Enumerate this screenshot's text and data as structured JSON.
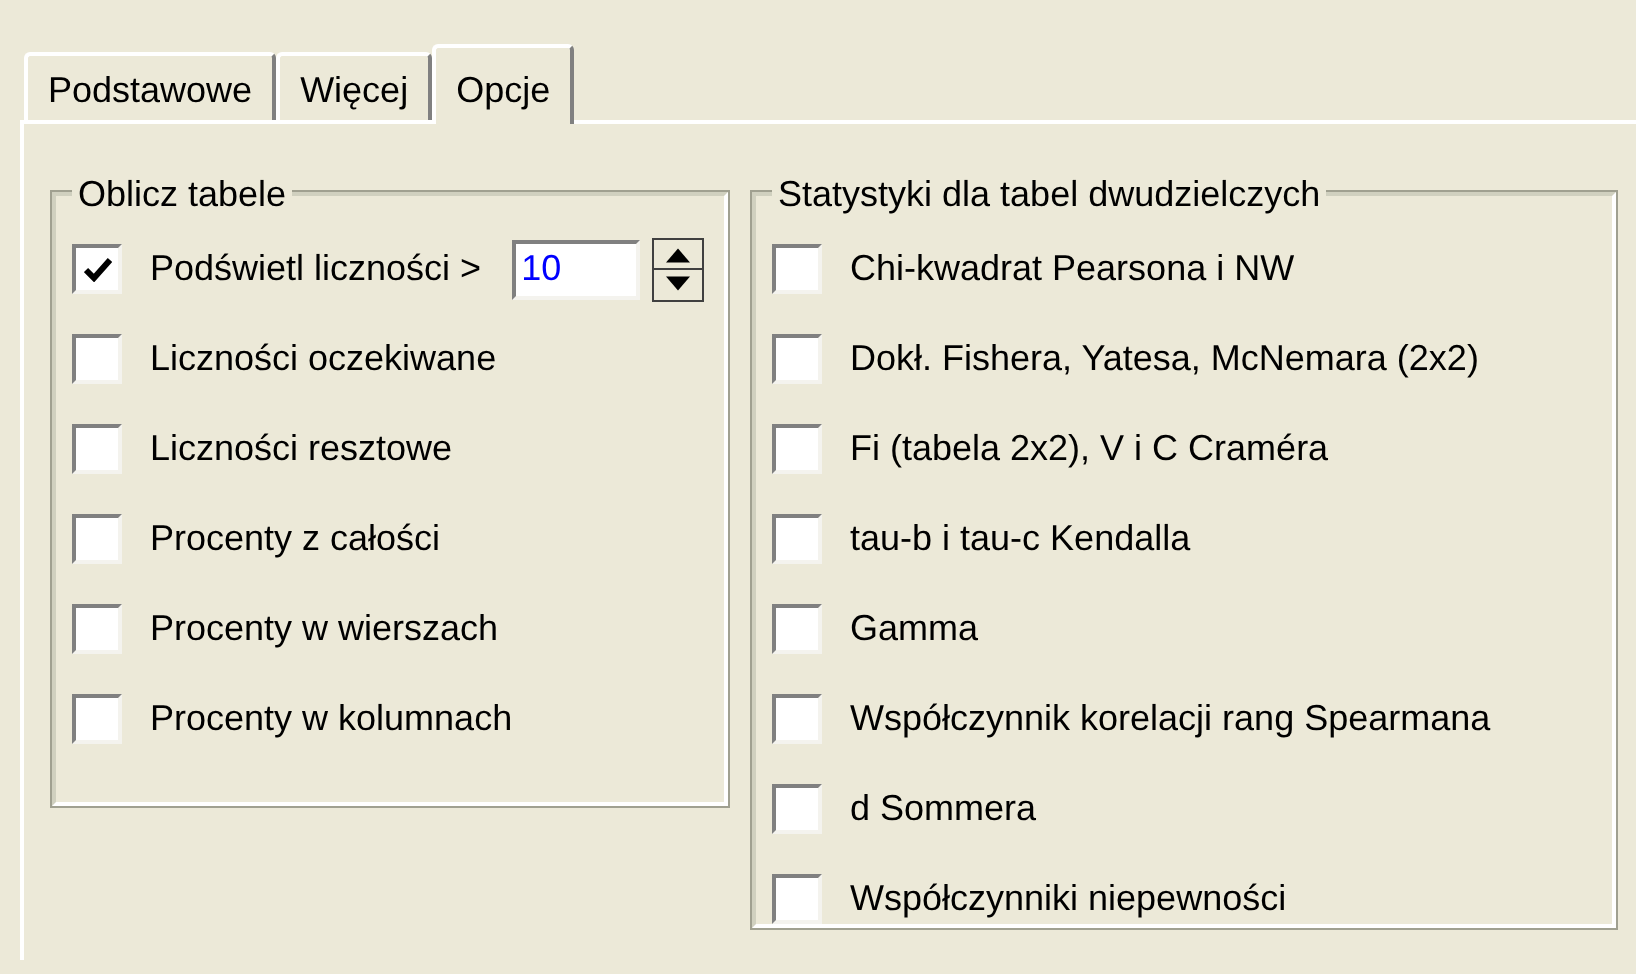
{
  "tabs": [
    {
      "label": "Podstawowe",
      "selected": false
    },
    {
      "label": "Więcej",
      "selected": false
    },
    {
      "label": "Opcje",
      "selected": true
    }
  ],
  "groups": [
    {
      "title": "Oblicz tabele",
      "items": [
        {
          "label": "Podświetl liczności >",
          "checked": true,
          "kind": "spinner",
          "value": "10"
        },
        {
          "label": "Liczności oczekiwane",
          "checked": false,
          "kind": "checkbox"
        },
        {
          "label": "Liczności resztowe",
          "checked": false,
          "kind": "checkbox"
        },
        {
          "label": "Procenty z całości",
          "checked": false,
          "kind": "checkbox"
        },
        {
          "label": "Procenty w wierszach",
          "checked": false,
          "kind": "checkbox"
        },
        {
          "label": "Procenty w kolumnach",
          "checked": false,
          "kind": "checkbox"
        }
      ]
    },
    {
      "title": "Statystyki dla tabel dwudzielczych",
      "items": [
        {
          "label": "Chi-kwadrat Pearsona i NW",
          "checked": false,
          "kind": "checkbox"
        },
        {
          "label": "Dokł. Fishera, Yatesa, McNemara (2x2)",
          "checked": false,
          "kind": "checkbox"
        },
        {
          "label": "Fi (tabela 2x2), V i C Craméra",
          "checked": false,
          "kind": "checkbox"
        },
        {
          "label": "tau-b i tau-c Kendalla",
          "checked": false,
          "kind": "checkbox"
        },
        {
          "label": "Gamma",
          "checked": false,
          "kind": "checkbox"
        },
        {
          "label": "Współczynnik korelacji rang Spearmana",
          "checked": false,
          "kind": "checkbox"
        },
        {
          "label": "d Sommera",
          "checked": false,
          "kind": "checkbox"
        },
        {
          "label": "Współczynniki niepewności",
          "checked": false,
          "kind": "checkbox"
        }
      ]
    }
  ]
}
